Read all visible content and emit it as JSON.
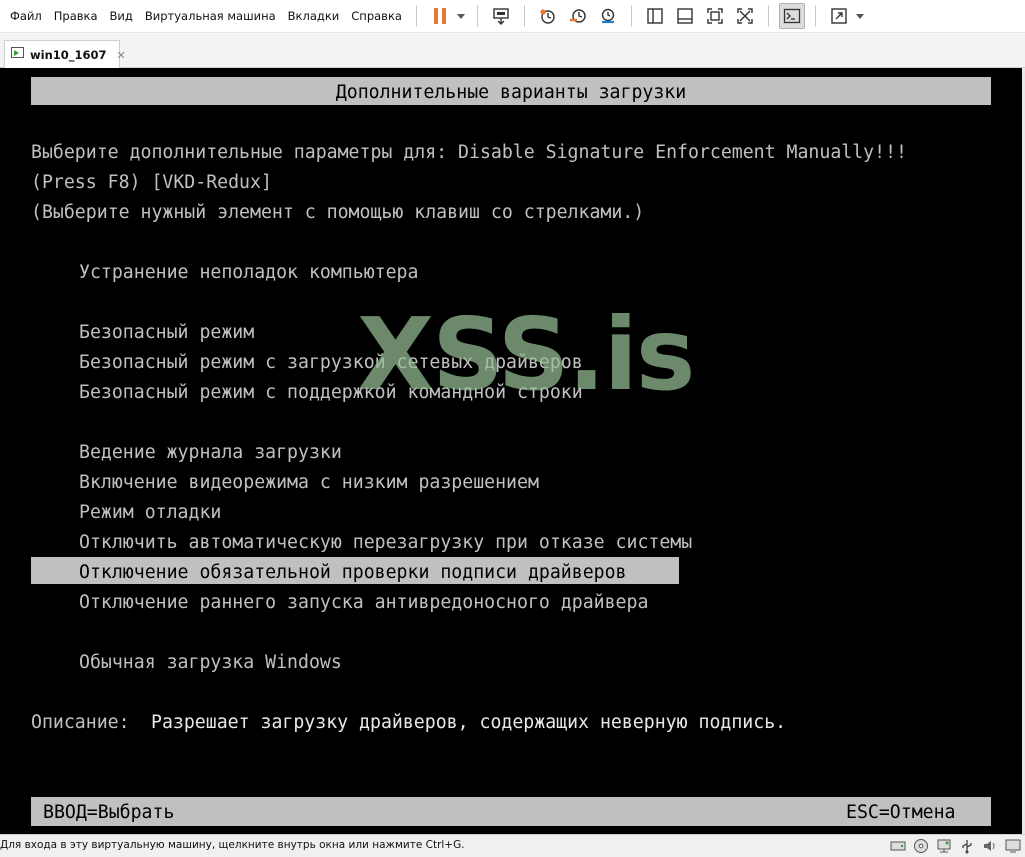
{
  "menu": {
    "items": [
      "Файл",
      "Правка",
      "Вид",
      "Виртуальная машина",
      "Вкладки",
      "Справка"
    ]
  },
  "toolbar": {
    "icons": [
      "pause-icon",
      "send-ctrl-alt-del-icon",
      "snapshot-icon",
      "revert-snapshot-icon",
      "manage-snapshots-icon",
      "show-library-icon",
      "thumbnail-bar-icon",
      "full-screen-icon",
      "unity-icon",
      "console-view-icon",
      "stretch-guest-icon"
    ],
    "accent": "#e8772e"
  },
  "tabs": [
    {
      "label": "win10_1607"
    }
  ],
  "boot_menu": {
    "header": "Дополнительные варианты загрузки",
    "prompt_line1": "Выберите дополнительные параметры для: Disable Signature Enforcement Manually!!!",
    "prompt_line2": "(Press F8) [VKD-Redux]",
    "hint": "(Выберите нужный элемент с помощью клавиш со стрелками.)",
    "options": {
      "troubleshoot": "Устранение неполадок компьютера",
      "safe_mode": "Безопасный режим",
      "safe_mode_network": "Безопасный режим с загрузкой сетевых драйверов",
      "safe_mode_cmd": "Безопасный режим с поддержкой командной строки",
      "boot_logging": "Ведение журнала загрузки",
      "low_res_video": "Включение видеорежима с низким разрешением",
      "debugging": "Режим отладки",
      "disable_auto_restart": "Отключить автоматическую перезагрузку при отказе системы",
      "disable_driver_signature": "Отключение обязательной проверки подписи драйверов",
      "disable_elam": "Отключение раннего запуска антивредоносного драйвера",
      "normal_start": "Обычная загрузка Windows"
    },
    "selected_option": "disable_driver_signature",
    "description_label": "Описание:",
    "description_text": "Разрешает загрузку драйверов, содержащих неверную подпись.",
    "footer_enter": "ВВОД=Выбрать",
    "footer_esc": "ESC=Отмена",
    "text_color": "#c0c0c0",
    "background_color": "#000000"
  },
  "watermark": {
    "text": "XSS.is"
  },
  "statusbar": {
    "text": "Для входа в эту виртуальную машину, щелкните внутрь окна или нажмите Ctrl+G.",
    "icons": [
      "hard-disk-icon",
      "cd-dvd-icon",
      "network-adapter-icon",
      "usb-controller-icon",
      "sound-card-icon",
      "display-icon"
    ]
  }
}
